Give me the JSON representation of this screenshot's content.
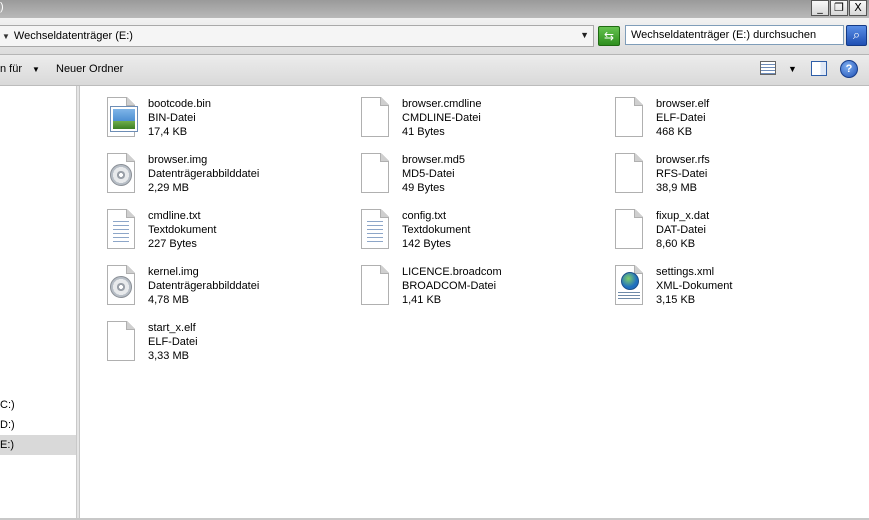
{
  "window": {
    "lead_glyph": ")",
    "btn_min": "_",
    "btn_max": "❐",
    "btn_close": "X"
  },
  "address": {
    "path_label": "Wechseldatenträger (E:)",
    "dropdown": "▼"
  },
  "search": {
    "placeholder": "Wechseldatenträger (E:) durchsuchen"
  },
  "toolbar": {
    "partial_item": "n für",
    "new_folder": "Neuer Ordner",
    "help": "?"
  },
  "nav": {
    "items": [
      {
        "label": "C:)"
      },
      {
        "label": "D:)"
      },
      {
        "label": "E:)"
      }
    ]
  },
  "files": [
    {
      "name": "bootcode.bin",
      "type": "BIN-Datei",
      "size": "17,4 KB",
      "icon": "image-file-icon"
    },
    {
      "name": "browser.cmdline",
      "type": "CMDLINE-Datei",
      "size": "41 Bytes",
      "icon": "blank-file-icon"
    },
    {
      "name": "browser.elf",
      "type": "ELF-Datei",
      "size": "468 KB",
      "icon": "blank-file-icon"
    },
    {
      "name": "browser.img",
      "type": "Datenträgerabbilddatei",
      "size": "2,29 MB",
      "icon": "disc-image-icon"
    },
    {
      "name": "browser.md5",
      "type": "MD5-Datei",
      "size": "49 Bytes",
      "icon": "blank-file-icon"
    },
    {
      "name": "browser.rfs",
      "type": "RFS-Datei",
      "size": "38,9 MB",
      "icon": "blank-file-icon"
    },
    {
      "name": "cmdline.txt",
      "type": "Textdokument",
      "size": "227 Bytes",
      "icon": "text-file-icon"
    },
    {
      "name": "config.txt",
      "type": "Textdokument",
      "size": "142 Bytes",
      "icon": "text-file-icon"
    },
    {
      "name": "fixup_x.dat",
      "type": "DAT-Datei",
      "size": "8,60 KB",
      "icon": "blank-file-icon"
    },
    {
      "name": "kernel.img",
      "type": "Datenträgerabbilddatei",
      "size": "4,78 MB",
      "icon": "disc-image-icon"
    },
    {
      "name": "LICENCE.broadcom",
      "type": "BROADCOM-Datei",
      "size": "1,41 KB",
      "icon": "blank-file-icon"
    },
    {
      "name": "settings.xml",
      "type": "XML-Dokument",
      "size": "3,15 KB",
      "icon": "xml-file-icon"
    },
    {
      "name": "start_x.elf",
      "type": "ELF-Datei",
      "size": "3,33 MB",
      "icon": "blank-file-icon"
    }
  ]
}
